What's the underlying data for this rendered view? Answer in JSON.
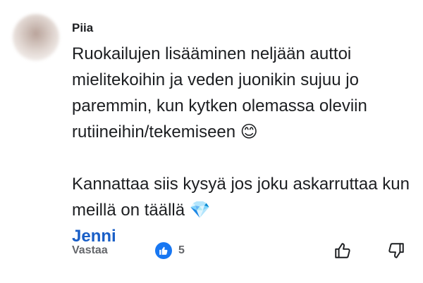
{
  "comment": {
    "author": "Piia",
    "paragraphs": [
      {
        "text": "Ruokailujen lisääminen neljään auttoi mielitekoihin ja veden juonikin sujuu jo paremmin, kun kytken olemassa oleviin rutiineihin/tekemiseen",
        "emoji": "😊"
      },
      {
        "text": "Kannattaa siis kysyä jos joku askarruttaa kun meillä on täällä",
        "emoji": "💎"
      }
    ],
    "mention": "Jenni"
  },
  "actions": {
    "reply_label": "Vastaa",
    "like_count": "5"
  },
  "colors": {
    "mention": "#1a5fc7",
    "like_badge": "#1877f2",
    "muted_text": "#65676b"
  },
  "icons": [
    "avatar-image",
    "like-badge-icon",
    "thumbs-up-icon",
    "thumbs-down-icon"
  ]
}
